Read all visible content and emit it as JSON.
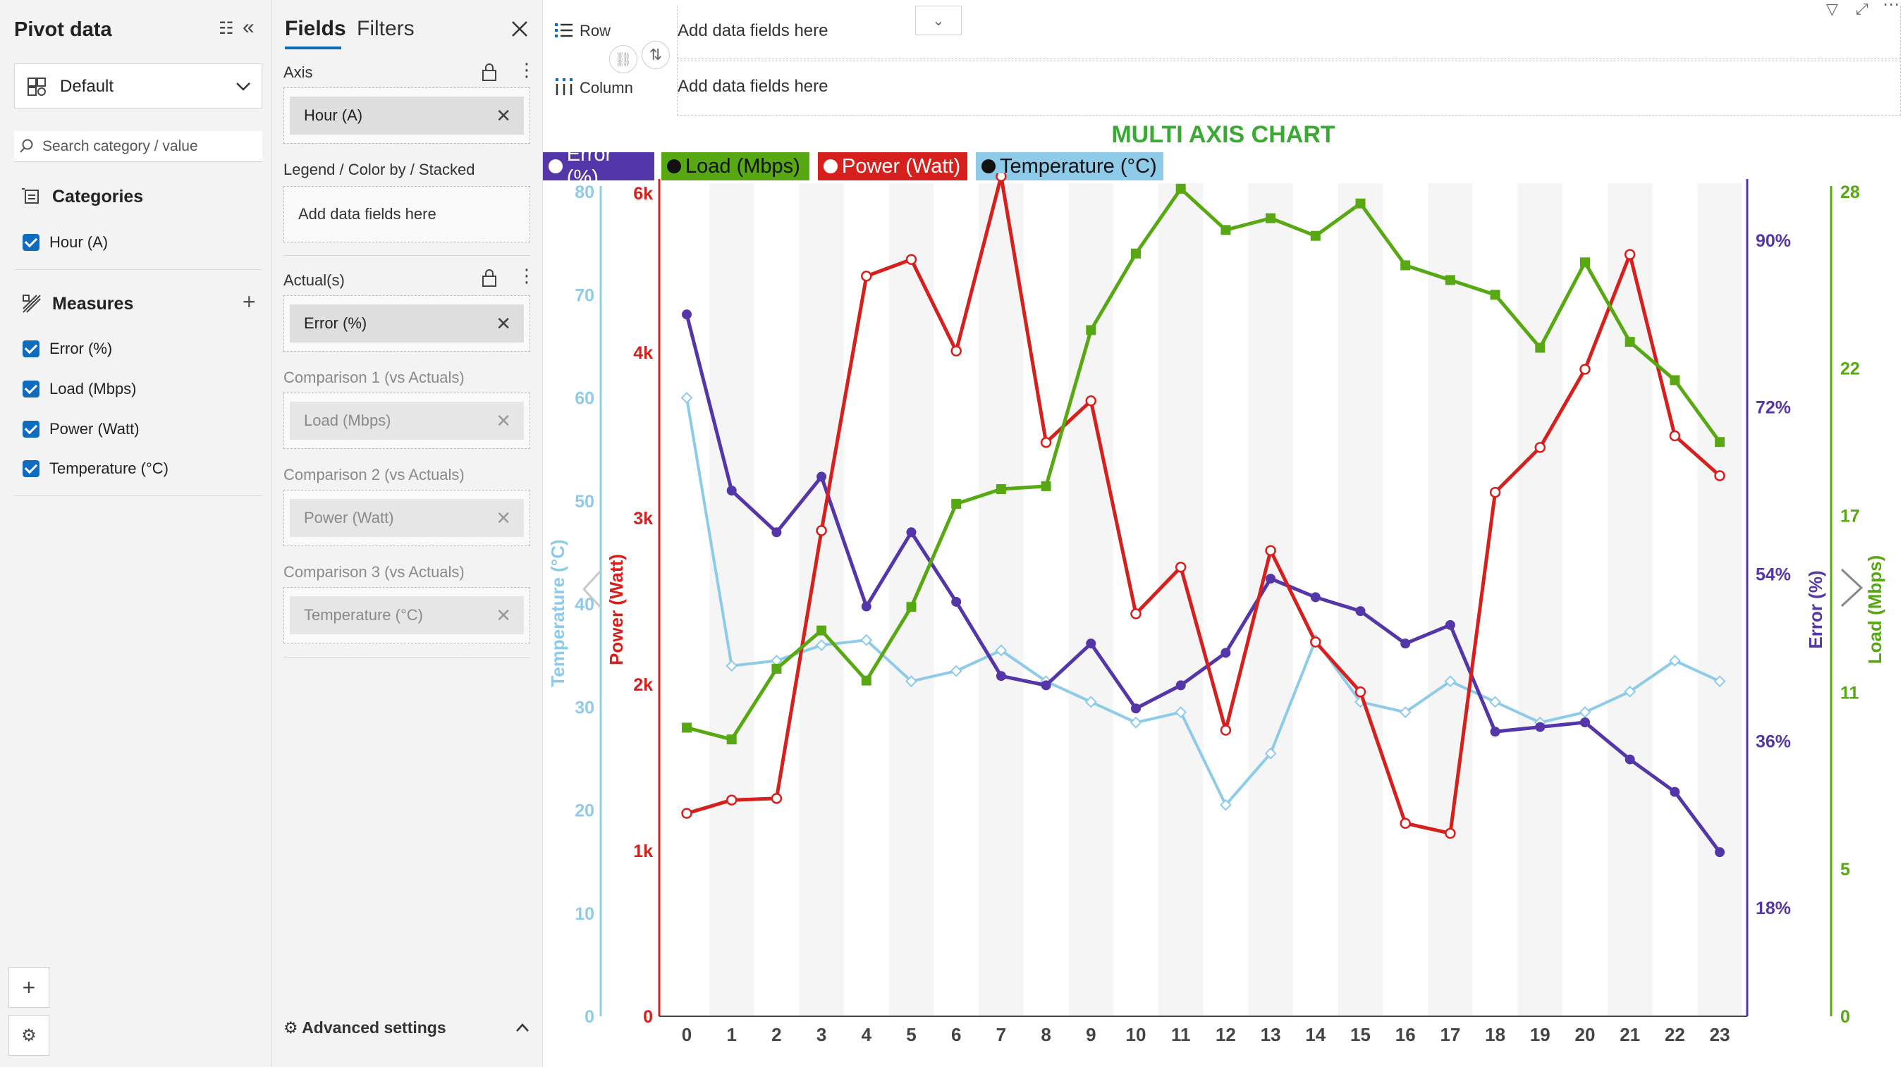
{
  "pivot": {
    "title": "Pivot data",
    "dataset": "Default",
    "search_placeholder": "Search category / value",
    "categories_label": "Categories",
    "categories": [
      "Hour (A)"
    ],
    "measures_label": "Measures",
    "measures": [
      "Error (%)",
      "Load (Mbps)",
      "Power (Watt)",
      "Temperature (°C)"
    ]
  },
  "fields": {
    "tabs": [
      "Fields",
      "Filters"
    ],
    "axis_label": "Axis",
    "axis_chip": "Hour (A)",
    "legend_label": "Legend / Color by / Stacked",
    "legend_placeholder": "Add data fields here",
    "actuals_label": "Actual(s)",
    "actuals_chip": "Error (%)",
    "comparisons": [
      {
        "label": "Comparison 1 (vs Actuals)",
        "chip": "Load (Mbps)"
      },
      {
        "label": "Comparison 2 (vs Actuals)",
        "chip": "Power (Watt)"
      },
      {
        "label": "Comparison 3 (vs Actuals)",
        "chip": "Temperature (°C)"
      }
    ],
    "advanced": "Advanced settings"
  },
  "dropzones": {
    "row_label": "Row",
    "column_label": "Column",
    "row_placeholder": "Add data fields here",
    "column_placeholder": "Add data fields here"
  },
  "colors": {
    "error": "#5436a9",
    "load": "#57a813",
    "power": "#d6201d",
    "temperature": "#8ecbe9",
    "title": "#3aaa35",
    "accent": "#0f6cbd"
  },
  "chart_data": {
    "type": "line",
    "title": "MULTI AXIS CHART",
    "x": [
      0,
      1,
      2,
      3,
      4,
      5,
      6,
      7,
      8,
      9,
      10,
      11,
      12,
      13,
      14,
      15,
      16,
      17,
      18,
      19,
      20,
      21,
      22,
      23
    ],
    "legend_position": "top-left",
    "grid": "alternating vertical bands",
    "axes": {
      "temperature": {
        "label": "Temperature (°C)",
        "side": "left",
        "ticks": [
          "0",
          "10",
          "20",
          "30",
          "40",
          "50",
          "60",
          "70",
          "80"
        ],
        "range": [
          0,
          80
        ]
      },
      "power": {
        "label": "Power (Watt)",
        "side": "left",
        "ticks": [
          "0",
          "1k",
          "2k",
          "3k",
          "4k",
          "6k"
        ],
        "range": [
          0,
          5000
        ]
      },
      "error": {
        "label": "Error (%)",
        "side": "right",
        "ticks": [
          "18%",
          "36%",
          "54%",
          "72%",
          "90%"
        ],
        "range": [
          6.3,
          96
        ]
      },
      "load": {
        "label": "Load (Mbps)",
        "side": "right",
        "ticks": [
          "0",
          "5",
          "11",
          "17",
          "22",
          "28"
        ],
        "range": [
          0,
          28
        ]
      }
    },
    "series": [
      {
        "name": "Error (%)",
        "axis": "error",
        "marker": "circle-filled",
        "values": [
          82,
          63,
          58.5,
          64.5,
          50.5,
          58.5,
          51,
          43,
          42,
          46.5,
          39.5,
          42,
          45.5,
          53.5,
          51.5,
          50,
          46.5,
          48.5,
          37,
          37.5,
          38,
          34,
          30.5,
          24
        ]
      },
      {
        "name": "Load (Mbps)",
        "axis": "load",
        "marker": "square",
        "values": [
          9.8,
          9.4,
          11.8,
          13.1,
          11.4,
          13.9,
          17.4,
          17.9,
          18,
          23.3,
          25.9,
          28.1,
          26.7,
          27.1,
          26.5,
          27.6,
          25.5,
          25,
          24.5,
          22.7,
          25.6,
          22.9,
          21.6,
          19.5
        ]
      },
      {
        "name": "Power (Watt)",
        "axis": "power",
        "marker": "circle-open",
        "values": [
          1220,
          1300,
          1310,
          2920,
          4450,
          4550,
          4000,
          5050,
          3450,
          3700,
          2420,
          2700,
          1720,
          2800,
          2250,
          1950,
          1160,
          1100,
          3150,
          3420,
          3890,
          4580,
          3490,
          3250
        ]
      },
      {
        "name": "Temperature (°C)",
        "axis": "temperature",
        "marker": "diamond-open",
        "values": [
          60,
          34,
          34.5,
          36,
          36.5,
          32.5,
          33.5,
          35.5,
          32.5,
          30.5,
          28.5,
          29.5,
          20.5,
          25.5,
          36.5,
          30.5,
          29.5,
          32.5,
          30.5,
          28.5,
          29.5,
          31.5,
          34.5,
          32.5
        ]
      }
    ]
  }
}
